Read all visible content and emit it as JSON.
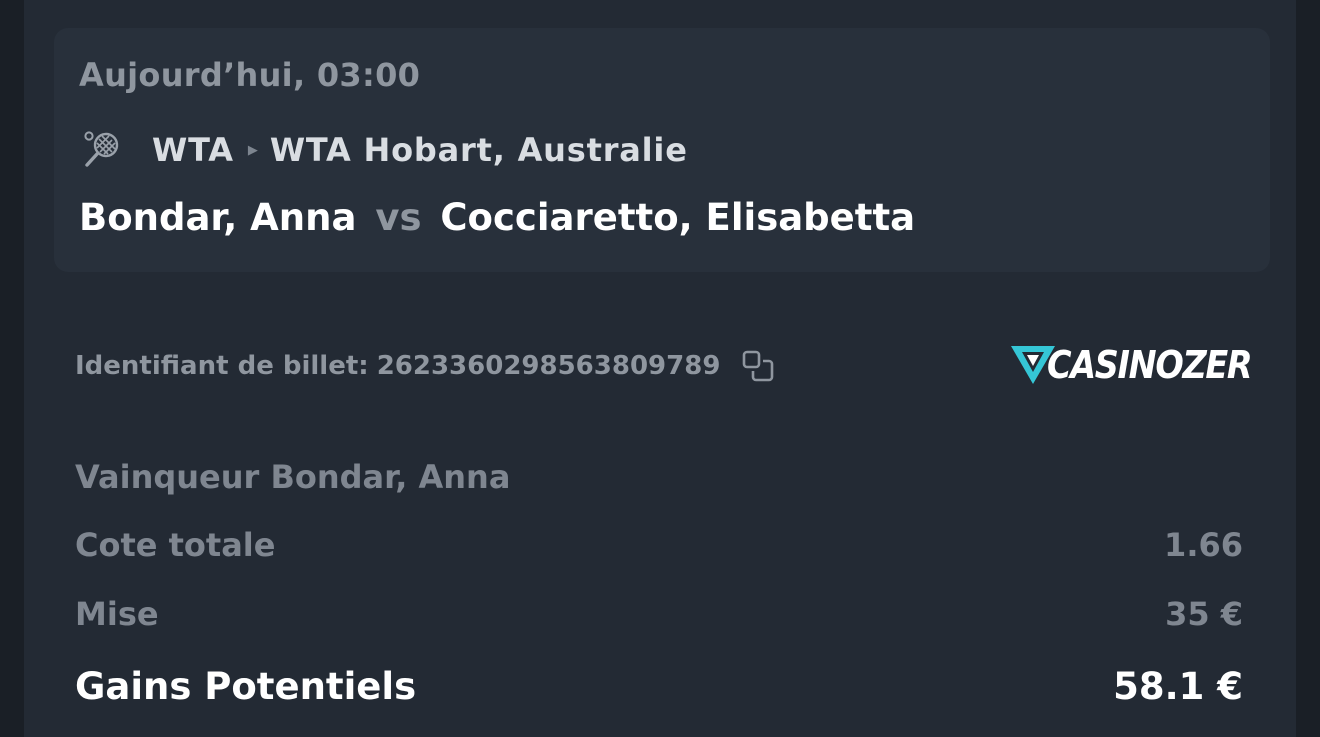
{
  "event": {
    "datetime": "Aujourd’hui, 03:00",
    "sport_icon": "tennis-racket-icon",
    "league": "WTA",
    "tournament": "WTA Hobart, Australie",
    "player1": "Bondar, Anna",
    "vs": "vs",
    "player2": "Cocciaretto, Elisabetta"
  },
  "ticket": {
    "label": "Identifiant de billet:",
    "id": "2623360298563809789",
    "copy_icon": "copy-icon"
  },
  "brand": {
    "name": "CASINOZER",
    "accent_color": "#35c6d6"
  },
  "bet": {
    "selection": "Vainqueur Bondar, Anna",
    "odds_label": "Cote totale",
    "odds_value": "1.66",
    "stake_label": "Mise",
    "stake_value": "35 €",
    "gains_label": "Gains Potentiels",
    "gains_value": "58.1 €"
  }
}
